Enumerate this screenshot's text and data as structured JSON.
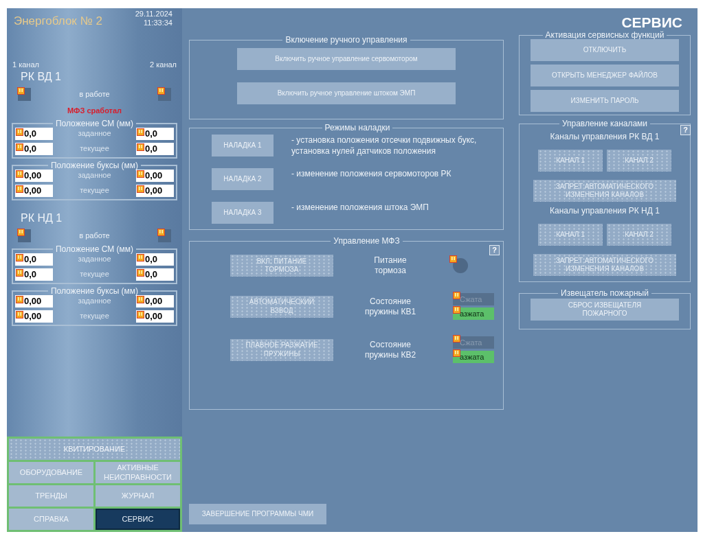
{
  "header": {
    "title": "Энергоблок № 2",
    "date": "29.11.2024",
    "time": "11:33:34"
  },
  "channel_labels": [
    "1 канал",
    "2 канал"
  ],
  "units": [
    {
      "name": "РК ВД 1",
      "status_label": "в работе",
      "alarm": "МФЗ сработал",
      "groups": [
        {
          "title": "Положение СМ (мм)",
          "rows": [
            {
              "label": "заданное",
              "values": [
                "0,0",
                "0,0"
              ]
            },
            {
              "label": "текущее",
              "values": [
                "0,0",
                "0,0"
              ]
            }
          ]
        },
        {
          "title": "Положение буксы (мм)",
          "rows": [
            {
              "label": "заданное",
              "values": [
                "0,00",
                "0,00"
              ]
            },
            {
              "label": "текущее",
              "values": [
                "0,00",
                "0,00"
              ]
            }
          ]
        }
      ]
    },
    {
      "name": "РК НД 1",
      "status_label": "в работе",
      "groups": [
        {
          "title": "Положение СМ (мм)",
          "rows": [
            {
              "label": "заданное",
              "values": [
                "0,0",
                "0,0"
              ]
            },
            {
              "label": "текущее",
              "values": [
                "0,0",
                "0,0"
              ]
            }
          ]
        },
        {
          "title": "Положение буксы (мм)",
          "rows": [
            {
              "label": "заданное",
              "values": [
                "0,00",
                "0,00"
              ]
            },
            {
              "label": "текущее",
              "values": [
                "0,00",
                "0,00"
              ]
            }
          ]
        }
      ]
    }
  ],
  "nav": [
    {
      "label": "КВИТИРОВАНИЕ",
      "selected": false,
      "disabled": true
    },
    {
      "label": "ОБОРУДОВАНИЕ",
      "selected": false,
      "disabled": false
    },
    {
      "label": "АКТИВНЫЕ НЕИСПРАВНОСТИ",
      "selected": false,
      "disabled": false
    },
    {
      "label": "ТРЕНДЫ",
      "selected": false,
      "disabled": false
    },
    {
      "label": "ЖУРНАЛ",
      "selected": false,
      "disabled": false
    },
    {
      "label": "СПРАВКА",
      "selected": false,
      "disabled": false
    },
    {
      "label": "СЕРВИС",
      "selected": true,
      "disabled": false
    }
  ],
  "page_title": "СЕРВИС",
  "manual": {
    "title": "Включение ручного управления",
    "buttons": [
      "Включить ручное управление сервомотором",
      "Включить ручное управление штоком ЭМП"
    ]
  },
  "tuning": {
    "title": "Режимы наладки",
    "rows": [
      {
        "button": "НАЛАДКА 1",
        "description": "- установка положения отсечки подвижных букс, установка нулей датчиков положения"
      },
      {
        "button": "НАЛАДКА 2",
        "description": "- изменение положения сервомоторов РК"
      },
      {
        "button": "НАЛАДКА 3",
        "description": "- изменение положения штока ЭМП"
      }
    ]
  },
  "mfz": {
    "title": "Управление МФЗ",
    "help": "?",
    "rows": [
      {
        "button": "ВКЛ. ПИТАНИЕ ТОРМОЗА",
        "disabled": true,
        "label": "Питание тормоза",
        "kind": "lamp",
        "on": false
      },
      {
        "button": "АВТОМАТИЧЕСКИЙ ВЗВОД",
        "disabled": true,
        "label": "Состояние пружины КВ1",
        "kind": "spring",
        "states": [
          {
            "label": "Сжата",
            "active": false
          },
          {
            "label": "азжата",
            "active": true
          }
        ]
      },
      {
        "button": "ПЛАВНОЕ РАЗЖАТИЕ ПРУЖИНЫ",
        "disabled": true,
        "label": "Состояние пружины КВ2",
        "kind": "spring",
        "states": [
          {
            "label": "Сжата",
            "active": false
          },
          {
            "label": "азжата",
            "active": true
          }
        ]
      }
    ]
  },
  "service": {
    "title": "Активация сервисных функций",
    "buttons": [
      "ОТКЛЮЧИТЬ",
      "ОТКРЫТЬ МЕНЕДЖЕР ФАЙЛОВ",
      "ИЗМЕНИТЬ ПАРОЛЬ"
    ]
  },
  "channels": {
    "title": "Управление каналами",
    "help": "?",
    "groups": [
      {
        "title": "Каналы управления РК ВД 1",
        "buttons": [
          {
            "label": "КАНАЛ 1",
            "disabled": true
          },
          {
            "label": "КАНАЛ 2",
            "disabled": true
          }
        ],
        "lock": {
          "label": "ЗАПРЕТ АВТОМАТИЧЕСКОГО ИЗМЕНЕНИЯ КАНАЛОВ",
          "disabled": true
        }
      },
      {
        "title": "Каналы управления РК НД 1",
        "buttons": [
          {
            "label": "КАНАЛ 1",
            "disabled": true
          },
          {
            "label": "КАНАЛ 2",
            "disabled": true
          }
        ],
        "lock": {
          "label": "ЗАПРЕТ АВТОМАТИЧЕСКОГО ИЗМЕНЕНИЯ КАНАЛОВ",
          "disabled": true
        }
      }
    ]
  },
  "fire": {
    "title": "Извещатель пожарный",
    "button": "СБРОС ИЗВЕЩАТЕЛЯ ПОЖАРНОГО"
  },
  "exit_button": "ЗАВЕРШЕНИЕ ПРОГРАММЫ ЧМИ"
}
